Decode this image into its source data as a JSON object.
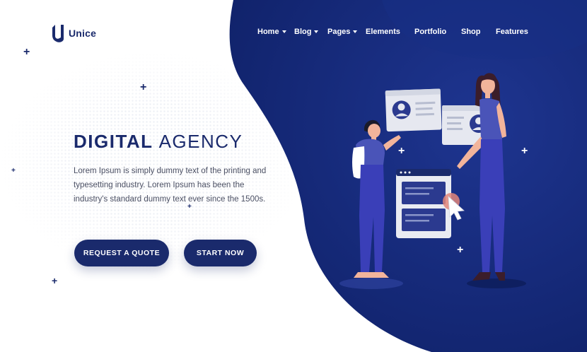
{
  "brand": {
    "name": "Unice",
    "logo_icon": "brand-logo-icon",
    "primary_color": "#1a2a6c",
    "accent_color": "#152a78"
  },
  "nav": {
    "items": [
      {
        "label": "Home",
        "has_dropdown": true
      },
      {
        "label": "Blog",
        "has_dropdown": true
      },
      {
        "label": "Pages",
        "has_dropdown": true
      },
      {
        "label": "Elements",
        "has_dropdown": false
      },
      {
        "label": "Portfolio",
        "has_dropdown": false
      },
      {
        "label": "Shop",
        "has_dropdown": false
      },
      {
        "label": "Features",
        "has_dropdown": false
      }
    ]
  },
  "hero": {
    "title_bold": "DIGITAL",
    "title_light": "AGENCY",
    "description": "Lorem Ipsum is simply dummy text of the printing and typesetting industry. Lorem Ipsum has been the industry's standard dummy text ever since the 1500s.",
    "primary_button": "REQUEST A QUOTE",
    "secondary_button": "START NOW"
  }
}
